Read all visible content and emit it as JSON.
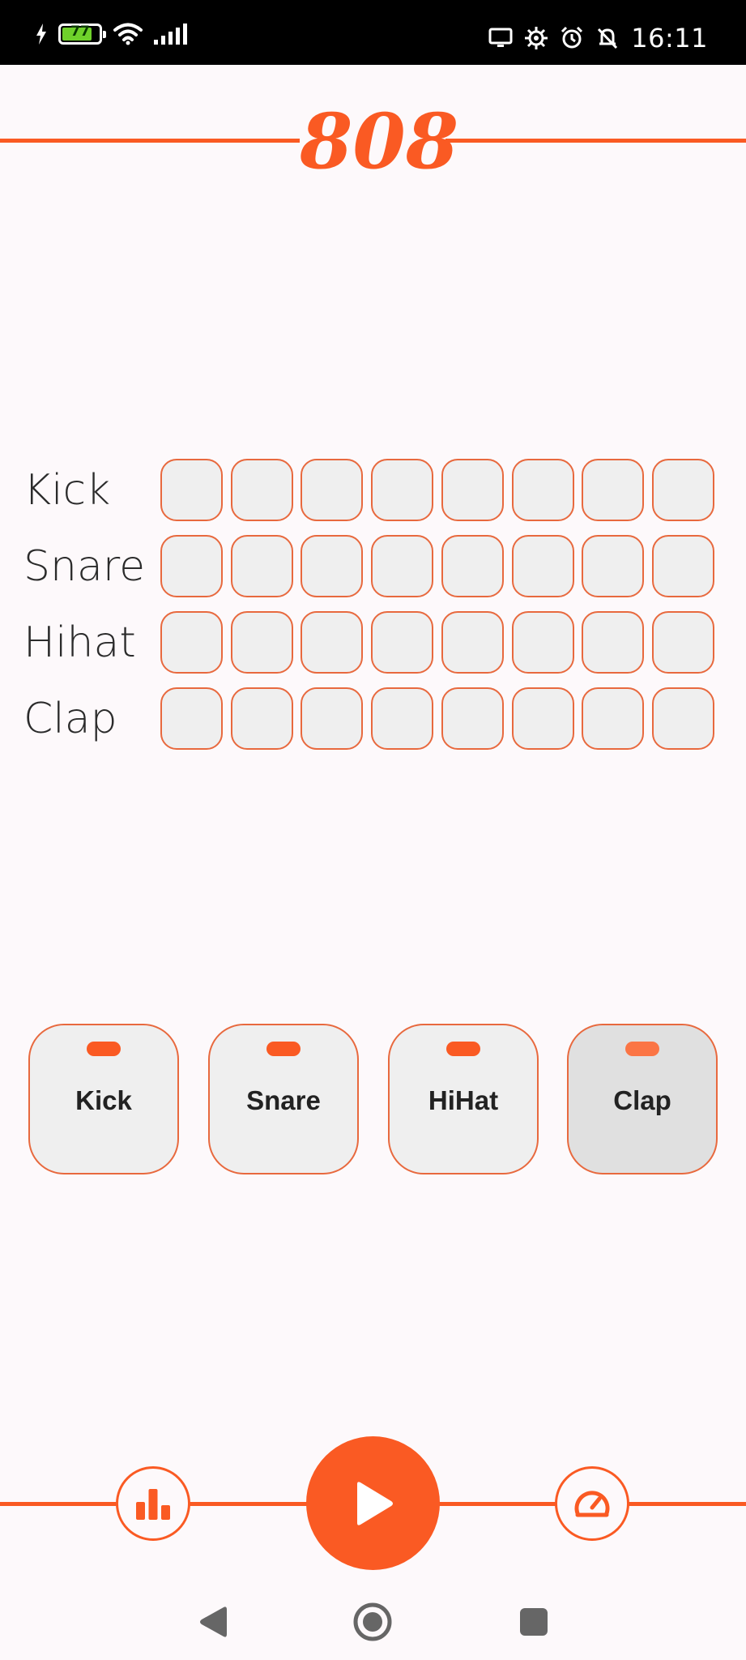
{
  "status_bar": {
    "time": "16:11",
    "battery_level": "77",
    "battery_fraction": 0.77,
    "icons": [
      "charging-bolt-icon",
      "battery-icon",
      "wifi-icon",
      "cellular-signal-icon",
      "screen-cast-icon",
      "settings-cog-icon",
      "alarm-icon",
      "notifications-off-icon"
    ]
  },
  "header": {
    "title": "808"
  },
  "sequencer": {
    "rows": [
      {
        "label": "Kick",
        "steps": [
          false,
          false,
          false,
          false,
          false,
          false,
          false,
          false
        ]
      },
      {
        "label": "Snare",
        "steps": [
          false,
          false,
          false,
          false,
          false,
          false,
          false,
          false
        ]
      },
      {
        "label": "Hihat",
        "steps": [
          false,
          false,
          false,
          false,
          false,
          false,
          false,
          false
        ]
      },
      {
        "label": "Clap",
        "steps": [
          false,
          false,
          false,
          false,
          false,
          false,
          false,
          false
        ]
      }
    ]
  },
  "pads": [
    {
      "label": "Kick",
      "active": false
    },
    {
      "label": "Snare",
      "active": false
    },
    {
      "label": "HiHat",
      "active": false
    },
    {
      "label": "Clap",
      "active": true
    }
  ],
  "transport": {
    "left_icon": "bar-chart-icon",
    "center_icon": "play-icon",
    "right_icon": "speedometer-icon"
  },
  "colors": {
    "accent": "#fa5a23",
    "background": "#fdf9fb",
    "cell": "#efefef",
    "cell_border": "#e8693e"
  },
  "nav_bar": {
    "icons": [
      "back-icon",
      "home-icon",
      "recents-icon"
    ]
  }
}
